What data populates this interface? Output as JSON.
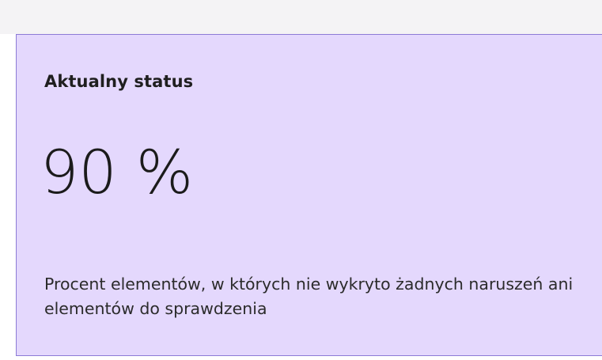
{
  "status_card": {
    "title": "Aktualny status",
    "value": "90 %",
    "description": "Procent elementów, w których nie wykryto żadnych naruszeń ani elementów do sprawdzenia"
  },
  "colors": {
    "card_background": "#e4d8fd",
    "card_border": "#8c7bd6",
    "page_background": "#f4f3f5"
  }
}
